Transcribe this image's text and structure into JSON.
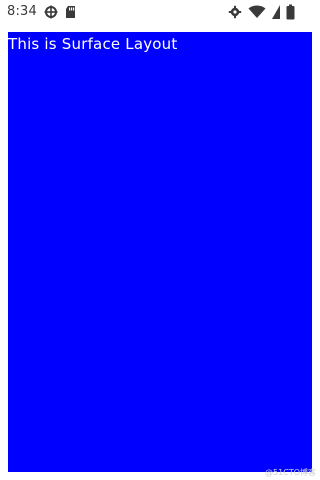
{
  "status_bar": {
    "time": "8:34",
    "left_icons": [
      "crosshair-circle-icon",
      "sd-card-icon"
    ],
    "right_icons": [
      "settings-gear-icon",
      "wifi-icon",
      "battery-icon"
    ]
  },
  "surface": {
    "text": "This is Surface Layout",
    "background": "#0000ff",
    "text_color": "#ffffff"
  },
  "watermark": {
    "text": "@51CTO博客"
  }
}
